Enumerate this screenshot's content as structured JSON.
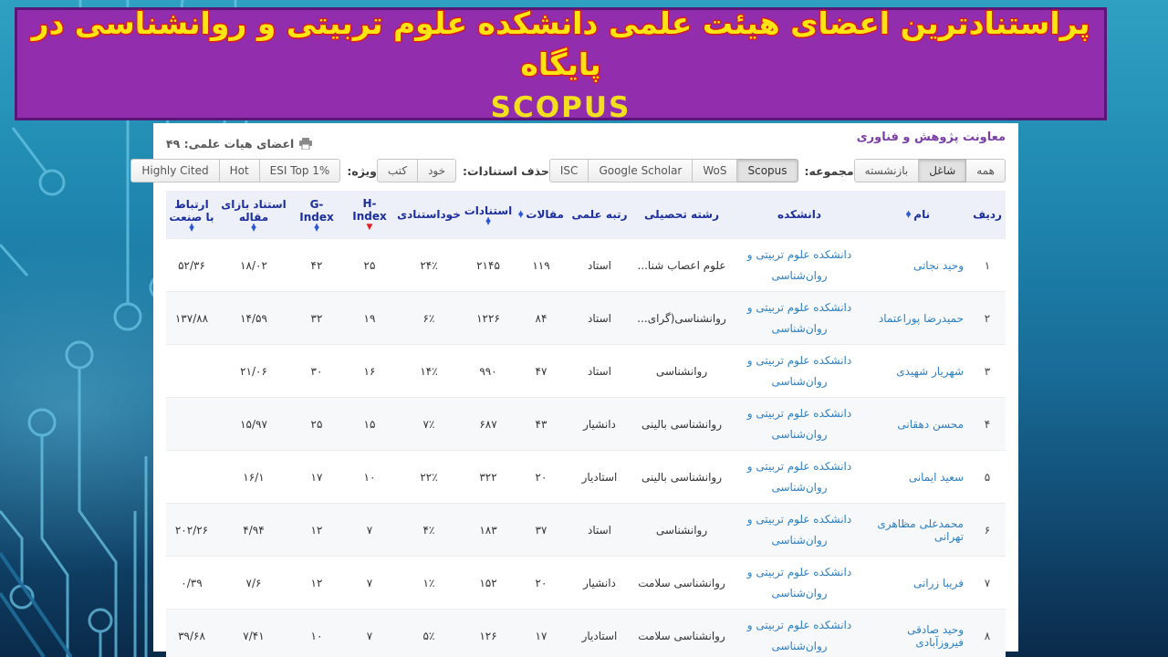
{
  "colors": {
    "banner_bg": "#922dae",
    "banner_border": "#5a1778",
    "banner_text_yellow": "#ffe414",
    "banner_text_outline_red": "#d81d1d",
    "background_teal_top": "#2fa0c2",
    "background_navy_bottom": "#0a2a4a",
    "table_header_bg": "#edeff9",
    "table_header_text": "#1c2f9c",
    "link_blue": "#2e7fc1",
    "sort_arrow_blue": "#2b57d6",
    "sort_arrow_red": "#e02222",
    "dept_purple": "#7b3fa6"
  },
  "icons": {
    "sort_up": "▲",
    "sort_down": "▼",
    "sort_desc": "▼"
  },
  "banner": {
    "title_line1": "پراستنادترین اعضای هیئت علمی دانشکده علوم تربیتی و روانشناسی در پایگاه",
    "title_line2": "SCOPUS"
  },
  "panel": {
    "dept_title": "معاونت پژوهش و فناوری",
    "faculty_count_label": "اعضای هیات علمی: ۴۹",
    "toolbar": {
      "status_options": [
        {
          "label": "همه",
          "selected": false
        },
        {
          "label": "شاغل",
          "selected": true
        },
        {
          "label": "بازنشسته",
          "selected": false
        }
      ],
      "collection_label": "مجموعه:",
      "collection_options": [
        {
          "label": "Scopus",
          "selected": true
        },
        {
          "label": "WoS",
          "selected": false
        },
        {
          "label": "Google Scholar",
          "selected": false
        },
        {
          "label": "ISC",
          "selected": false
        }
      ],
      "remove_citations_label": "حذف استنادات:",
      "remove_citations_options": [
        {
          "label": "خود",
          "selected": false
        },
        {
          "label": "کتب",
          "selected": false
        }
      ],
      "special_label": "ویژه:",
      "special_options": [
        {
          "label": "ESI Top 1%",
          "selected": false
        },
        {
          "label": "Hot",
          "selected": false
        },
        {
          "label": "Highly Cited",
          "selected": false
        }
      ]
    }
  },
  "table": {
    "sorted_by": "H-Index (نزولی)",
    "columns": [
      {
        "label": "ردیف",
        "sort": "none"
      },
      {
        "label": "نام",
        "sort": "both"
      },
      {
        "label": "دانشکده",
        "sort": "none"
      },
      {
        "label": "رشته تحصیلی",
        "sort": "none"
      },
      {
        "label": "رتبه علمی",
        "sort": "none"
      },
      {
        "label": "مقالات",
        "sort": "both"
      },
      {
        "label": "استنادات",
        "sort": "both"
      },
      {
        "label": "خوداستنادی",
        "sort": "none"
      },
      {
        "label": "H-Index",
        "sort": "desc"
      },
      {
        "label": "G-Index",
        "sort": "both"
      },
      {
        "label": "استناد بازای مقاله",
        "sort": "both"
      },
      {
        "label": "ارتباط با صنعت",
        "sort": "both"
      }
    ],
    "rows": [
      {
        "num": "۱",
        "name": "وحید نجاتی",
        "faculty": "دانشکده علوم تربیتی و روان‌شناسی",
        "field": "علوم اعصاب شنا...",
        "rank": "استاد",
        "articles": "۱۱۹",
        "citations": "۲۱۴۵",
        "self_citation": "۲۴٪",
        "h_index": "۲۵",
        "g_index": "۴۲",
        "cite_per_article": "۱۸/۰۲",
        "industry": "۵۲/۳۶"
      },
      {
        "num": "۲",
        "name": "حمیدرضا پوراعتماد",
        "faculty": "دانشکده علوم تربیتی و روان‌شناسی",
        "field": "روانشناسی(گرای...",
        "rank": "استاد",
        "articles": "۸۴",
        "citations": "۱۲۲۶",
        "self_citation": "۶٪",
        "h_index": "۱۹",
        "g_index": "۳۲",
        "cite_per_article": "۱۴/۵۹",
        "industry": "۱۳۷/۸۸"
      },
      {
        "num": "۳",
        "name": "شهریار شهیدی",
        "faculty": "دانشکده علوم تربیتی و روان‌شناسی",
        "field": "روانشناسی",
        "rank": "استاد",
        "articles": "۴۷",
        "citations": "۹۹۰",
        "self_citation": "۱۴٪",
        "h_index": "۱۶",
        "g_index": "۳۰",
        "cite_per_article": "۲۱/۰۶",
        "industry": ""
      },
      {
        "num": "۴",
        "name": "محسن دهقانی",
        "faculty": "دانشکده علوم تربیتی و روان‌شناسی",
        "field": "روانشناسی بالینی",
        "rank": "دانشیار",
        "articles": "۴۳",
        "citations": "۶۸۷",
        "self_citation": "۷٪",
        "h_index": "۱۵",
        "g_index": "۲۵",
        "cite_per_article": "۱۵/۹۷",
        "industry": ""
      },
      {
        "num": "۵",
        "name": "سعید ایمانی",
        "faculty": "دانشکده علوم تربیتی و روان‌شناسی",
        "field": "روانشناسی بالینی",
        "rank": "استادیار",
        "articles": "۲۰",
        "citations": "۳۲۲",
        "self_citation": "۲۲٪",
        "h_index": "۱۰",
        "g_index": "۱۷",
        "cite_per_article": "۱۶/۱",
        "industry": ""
      },
      {
        "num": "۶",
        "name": "محمدعلی مظاهری تهرانی",
        "faculty": "دانشکده علوم تربیتی و روان‌شناسی",
        "field": "روانشناسی",
        "rank": "استاد",
        "articles": "۳۷",
        "citations": "۱۸۳",
        "self_citation": "۴٪",
        "h_index": "۷",
        "g_index": "۱۲",
        "cite_per_article": "۴/۹۴",
        "industry": "۲۰۲/۲۶"
      },
      {
        "num": "۷",
        "name": "فریبا زرانی",
        "faculty": "دانشکده علوم تربیتی و روان‌شناسی",
        "field": "روانشناسی سلامت",
        "rank": "دانشیار",
        "articles": "۲۰",
        "citations": "۱۵۲",
        "self_citation": "۱٪",
        "h_index": "۷",
        "g_index": "۱۲",
        "cite_per_article": "۷/۶",
        "industry": "۰/۳۹"
      },
      {
        "num": "۸",
        "name": "وحید صادقی فیروزآبادی",
        "faculty": "دانشکده علوم تربیتی و روان‌شناسی",
        "field": "روانشناسی سلامت",
        "rank": "استادیار",
        "articles": "۱۷",
        "citations": "۱۲۶",
        "self_citation": "۵٪",
        "h_index": "۷",
        "g_index": "۱۰",
        "cite_per_article": "۷/۴۱",
        "industry": "۳۹/۶۸"
      }
    ]
  }
}
